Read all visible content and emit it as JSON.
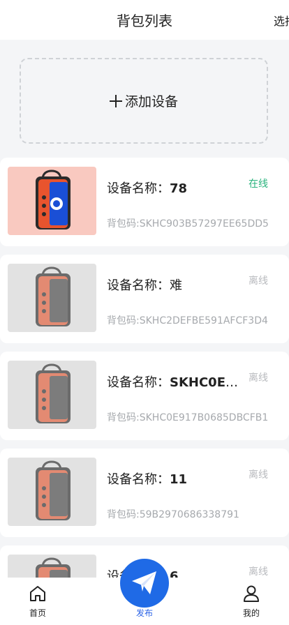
{
  "header": {
    "title": "背包列表",
    "action_label": "选择"
  },
  "add_device": {
    "label": "添加设备"
  },
  "name_prefix": "设备名称：",
  "code_prefix": "背包码:",
  "devices": [
    {
      "name": "78",
      "code": "SKHC903B57297EE65DD5",
      "status": "在线",
      "online": true
    },
    {
      "name": "难",
      "code": "SKHC2DEFBE591AFCF3D4",
      "status": "离线",
      "online": false
    },
    {
      "name": "SKHC0E917...",
      "code": "SKHC0E917B0685DBCFB1",
      "status": "离线",
      "online": false
    },
    {
      "name": "11",
      "code": "59B2970686338791",
      "status": "离线",
      "online": false
    },
    {
      "name": "6",
      "code": "",
      "status": "离线",
      "online": false
    }
  ],
  "nav": {
    "home": "首页",
    "publish": "发布",
    "mine": "我的"
  },
  "colors": {
    "online": "#29b37d",
    "offline": "#b8babe",
    "accent": "#1f6ae6"
  }
}
